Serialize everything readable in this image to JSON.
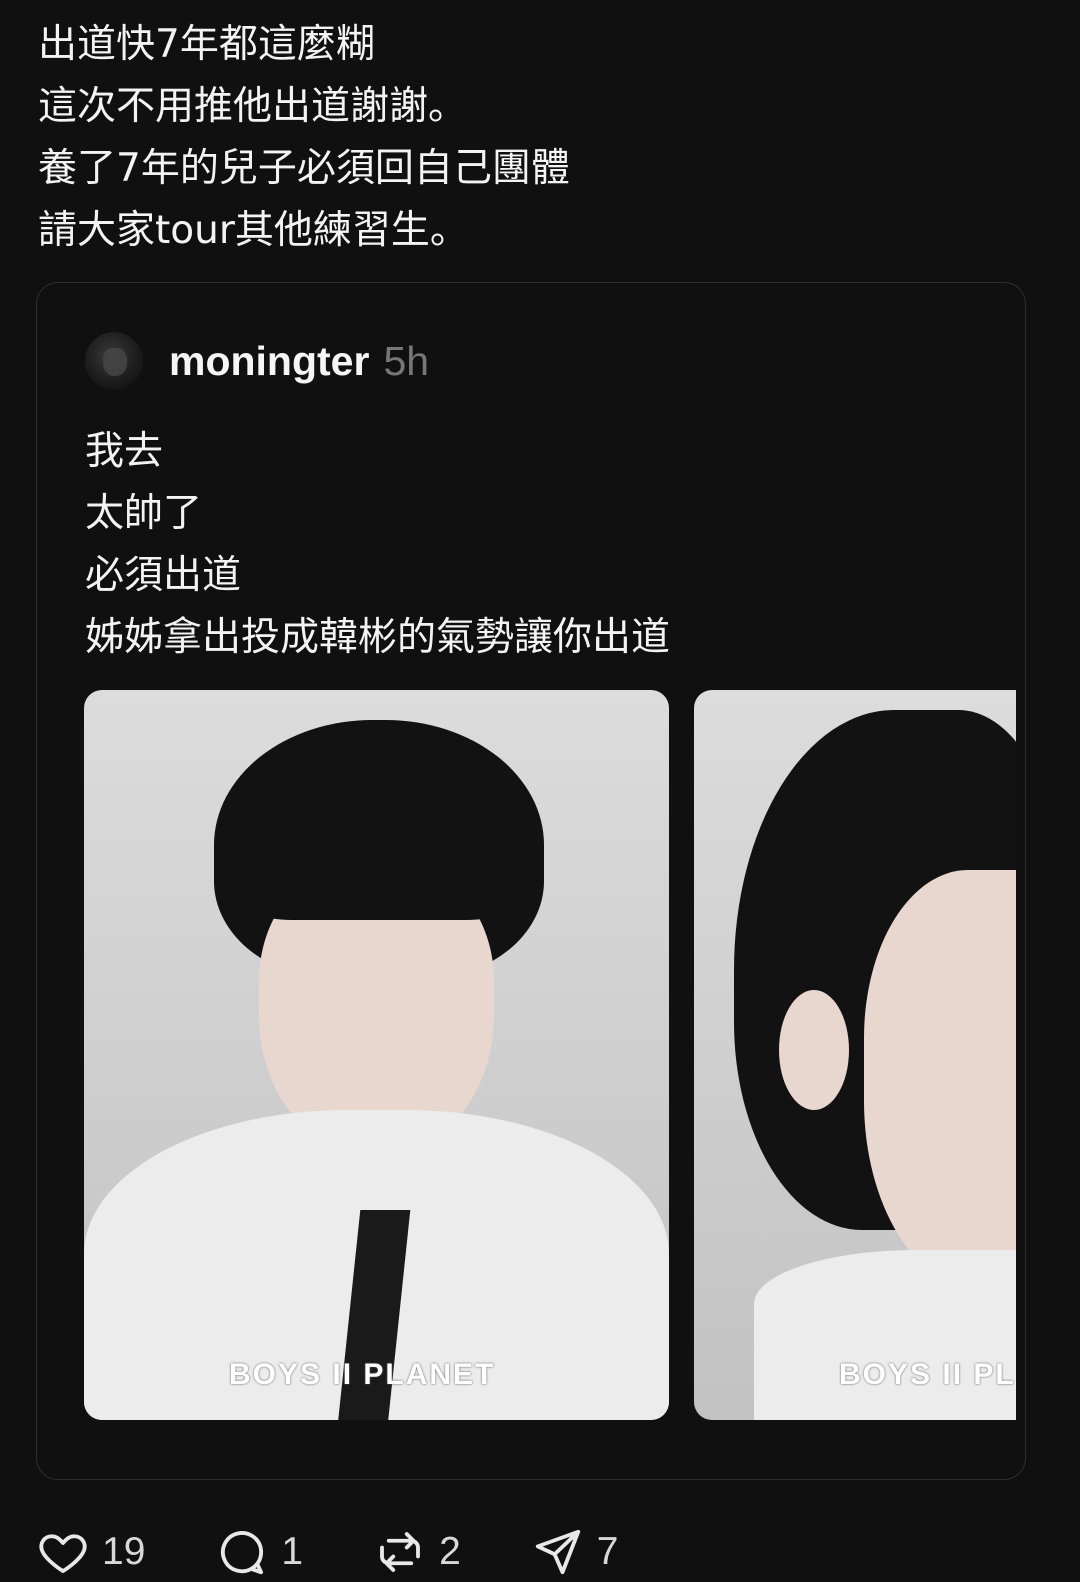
{
  "post": {
    "lines": [
      "出道快7年都這麼糊",
      "這次不用推他出道謝謝。",
      "養了7年的兒子必須回自己團體",
      "請大家tour其他練習生。"
    ]
  },
  "quoted_post": {
    "username": "moningter",
    "timestamp": "5h",
    "lines": [
      "我去",
      "太帥了",
      "必須出道",
      "姊姊拿出投成韓彬的氣勢讓你出道"
    ],
    "images": [
      {
        "watermark": "BOYS II PLANET"
      },
      {
        "watermark": "BOYS II PL"
      }
    ]
  },
  "actions": {
    "likes": "19",
    "replies": "1",
    "reposts": "2",
    "shares": "7"
  },
  "colors": {
    "background": "#101010",
    "text": "#f3f3f3",
    "muted": "#777777",
    "card_border": "#2f2f2f"
  }
}
